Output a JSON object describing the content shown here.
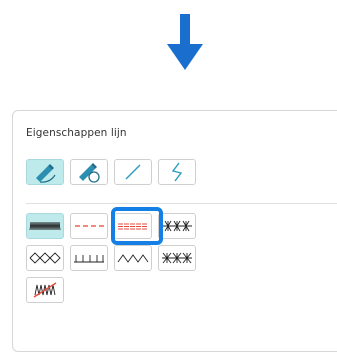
{
  "panel": {
    "title": "Eigenschappen lijn"
  },
  "line_tools": [
    {
      "icon": "pen-freehand-icon",
      "selected": true
    },
    {
      "icon": "pen-fill-icon",
      "selected": false
    },
    {
      "icon": "straight-line-icon",
      "selected": false
    },
    {
      "icon": "polyline-icon",
      "selected": false
    }
  ],
  "stitch_types": [
    {
      "icon": "zigzag-satin-stitch-icon",
      "selected": true
    },
    {
      "icon": "running-stitch-icon",
      "selected": false
    },
    {
      "icon": "triple-stitch-icon",
      "selected": false,
      "highlighted": true
    },
    {
      "icon": "star-stitch-icon",
      "selected": false
    },
    {
      "icon": "diamond-stitch-icon",
      "selected": false
    },
    {
      "icon": "blanket-stitch-icon",
      "selected": false
    },
    {
      "icon": "scallop-stitch-icon",
      "selected": false
    },
    {
      "icon": "cross-stitch-icon",
      "selected": false
    },
    {
      "icon": "no-stitch-icon",
      "selected": false
    }
  ],
  "colors": {
    "accent": "#1a6fce",
    "highlight": "#1480e6",
    "selected_bg": "#bfeaec",
    "stitch_red": "#e64a3c"
  }
}
